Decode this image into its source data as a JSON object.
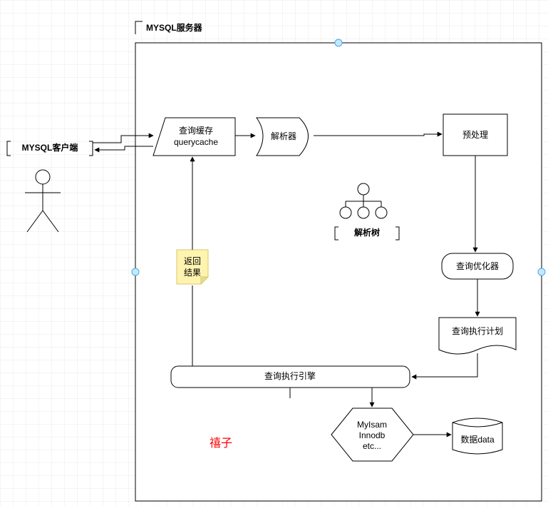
{
  "chart_data": {
    "type": "flowchart",
    "title": "MYSQL服务器",
    "nodes": [
      {
        "id": "client_label",
        "type": "label",
        "text": "MYSQL客户端"
      },
      {
        "id": "actor",
        "type": "actor",
        "text": ""
      },
      {
        "id": "server_frame",
        "type": "frame",
        "text": "MYSQL服务器"
      },
      {
        "id": "query_cache",
        "type": "process-skew",
        "text1": "查询缓存",
        "text2": "querycache"
      },
      {
        "id": "parser",
        "type": "process-bullet",
        "text": "解析器"
      },
      {
        "id": "parse_tree_label",
        "type": "label-bold",
        "text": "解析树"
      },
      {
        "id": "parse_tree",
        "type": "tree-graphic"
      },
      {
        "id": "preprocess",
        "type": "rect",
        "text": "预处理"
      },
      {
        "id": "optimizer",
        "type": "rounded",
        "text": "查询优化器"
      },
      {
        "id": "exec_plan",
        "type": "document",
        "text": "查询执行计划"
      },
      {
        "id": "exec_engine",
        "type": "rounded-wide",
        "text": "查询执行引擎"
      },
      {
        "id": "engines",
        "type": "hexagon",
        "text1": "MyIsam",
        "text2": "Innodb",
        "text3": "etc..."
      },
      {
        "id": "data",
        "type": "cylinder",
        "text": "数据data"
      },
      {
        "id": "return_note",
        "type": "sticky",
        "text1": "返回",
        "text2": "结果"
      },
      {
        "id": "watermark",
        "type": "watermark",
        "text": "禧子"
      }
    ],
    "edges": [
      {
        "from": "client_label",
        "to": "query_cache",
        "style": "bidirectional"
      },
      {
        "from": "query_cache",
        "to": "parser",
        "style": "arrow"
      },
      {
        "from": "parser",
        "to": "parse_tree",
        "style": "down-arrow"
      },
      {
        "from": "parser",
        "to": "preprocess",
        "style": "arrow-elbow"
      },
      {
        "from": "preprocess",
        "to": "optimizer",
        "style": "arrow"
      },
      {
        "from": "optimizer",
        "to": "exec_plan",
        "style": "arrow"
      },
      {
        "from": "exec_plan",
        "to": "exec_engine",
        "style": "arrow-elbow"
      },
      {
        "from": "exec_engine",
        "to": "engines",
        "style": "arrow"
      },
      {
        "from": "engines",
        "to": "data",
        "style": "arrow"
      },
      {
        "from": "exec_engine",
        "to": "query_cache",
        "style": "arrow-up",
        "label_node": "return_note"
      }
    ]
  },
  "labels": {
    "client": "MYSQL客户端",
    "server": "MYSQL服务器",
    "query_cache1": "查询缓存",
    "query_cache2": "querycache",
    "parser": "解析器",
    "parse_tree": "解析树",
    "preprocess": "预处理",
    "optimizer": "查询优化器",
    "exec_plan": "查询执行计划",
    "exec_engine": "查询执行引擎",
    "engine1": "MyIsam",
    "engine2": "Innodb",
    "engine3": "etc...",
    "data": "数据data",
    "note1": "返回",
    "note2": "结果",
    "watermark": "禧子"
  }
}
